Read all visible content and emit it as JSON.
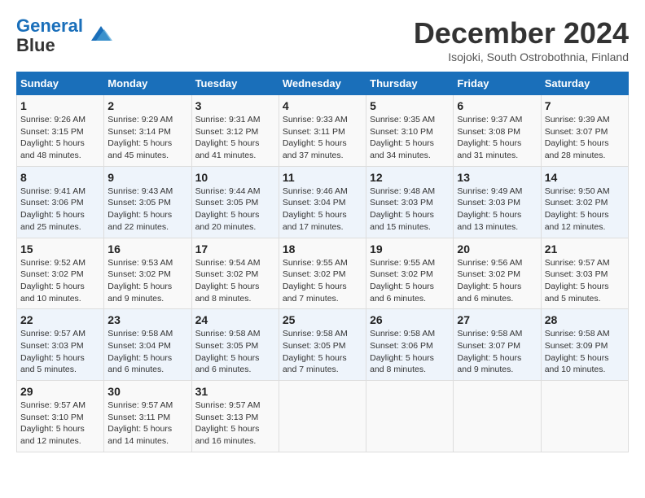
{
  "header": {
    "logo_line1": "General",
    "logo_line2": "Blue",
    "month_title": "December 2024",
    "location": "Isojoki, South Ostrobothnia, Finland"
  },
  "weekdays": [
    "Sunday",
    "Monday",
    "Tuesday",
    "Wednesday",
    "Thursday",
    "Friday",
    "Saturday"
  ],
  "weeks": [
    [
      {
        "day": "1",
        "sunrise": "9:26 AM",
        "sunset": "3:15 PM",
        "daylight": "5 hours and 48 minutes."
      },
      {
        "day": "2",
        "sunrise": "9:29 AM",
        "sunset": "3:14 PM",
        "daylight": "5 hours and 45 minutes."
      },
      {
        "day": "3",
        "sunrise": "9:31 AM",
        "sunset": "3:12 PM",
        "daylight": "5 hours and 41 minutes."
      },
      {
        "day": "4",
        "sunrise": "9:33 AM",
        "sunset": "3:11 PM",
        "daylight": "5 hours and 37 minutes."
      },
      {
        "day": "5",
        "sunrise": "9:35 AM",
        "sunset": "3:10 PM",
        "daylight": "5 hours and 34 minutes."
      },
      {
        "day": "6",
        "sunrise": "9:37 AM",
        "sunset": "3:08 PM",
        "daylight": "5 hours and 31 minutes."
      },
      {
        "day": "7",
        "sunrise": "9:39 AM",
        "sunset": "3:07 PM",
        "daylight": "5 hours and 28 minutes."
      }
    ],
    [
      {
        "day": "8",
        "sunrise": "9:41 AM",
        "sunset": "3:06 PM",
        "daylight": "5 hours and 25 minutes."
      },
      {
        "day": "9",
        "sunrise": "9:43 AM",
        "sunset": "3:05 PM",
        "daylight": "5 hours and 22 minutes."
      },
      {
        "day": "10",
        "sunrise": "9:44 AM",
        "sunset": "3:05 PM",
        "daylight": "5 hours and 20 minutes."
      },
      {
        "day": "11",
        "sunrise": "9:46 AM",
        "sunset": "3:04 PM",
        "daylight": "5 hours and 17 minutes."
      },
      {
        "day": "12",
        "sunrise": "9:48 AM",
        "sunset": "3:03 PM",
        "daylight": "5 hours and 15 minutes."
      },
      {
        "day": "13",
        "sunrise": "9:49 AM",
        "sunset": "3:03 PM",
        "daylight": "5 hours and 13 minutes."
      },
      {
        "day": "14",
        "sunrise": "9:50 AM",
        "sunset": "3:02 PM",
        "daylight": "5 hours and 12 minutes."
      }
    ],
    [
      {
        "day": "15",
        "sunrise": "9:52 AM",
        "sunset": "3:02 PM",
        "daylight": "5 hours and 10 minutes."
      },
      {
        "day": "16",
        "sunrise": "9:53 AM",
        "sunset": "3:02 PM",
        "daylight": "5 hours and 9 minutes."
      },
      {
        "day": "17",
        "sunrise": "9:54 AM",
        "sunset": "3:02 PM",
        "daylight": "5 hours and 8 minutes."
      },
      {
        "day": "18",
        "sunrise": "9:55 AM",
        "sunset": "3:02 PM",
        "daylight": "5 hours and 7 minutes."
      },
      {
        "day": "19",
        "sunrise": "9:55 AM",
        "sunset": "3:02 PM",
        "daylight": "5 hours and 6 minutes."
      },
      {
        "day": "20",
        "sunrise": "9:56 AM",
        "sunset": "3:02 PM",
        "daylight": "5 hours and 6 minutes."
      },
      {
        "day": "21",
        "sunrise": "9:57 AM",
        "sunset": "3:03 PM",
        "daylight": "5 hours and 5 minutes."
      }
    ],
    [
      {
        "day": "22",
        "sunrise": "9:57 AM",
        "sunset": "3:03 PM",
        "daylight": "5 hours and 5 minutes."
      },
      {
        "day": "23",
        "sunrise": "9:58 AM",
        "sunset": "3:04 PM",
        "daylight": "5 hours and 6 minutes."
      },
      {
        "day": "24",
        "sunrise": "9:58 AM",
        "sunset": "3:05 PM",
        "daylight": "5 hours and 6 minutes."
      },
      {
        "day": "25",
        "sunrise": "9:58 AM",
        "sunset": "3:05 PM",
        "daylight": "5 hours and 7 minutes."
      },
      {
        "day": "26",
        "sunrise": "9:58 AM",
        "sunset": "3:06 PM",
        "daylight": "5 hours and 8 minutes."
      },
      {
        "day": "27",
        "sunrise": "9:58 AM",
        "sunset": "3:07 PM",
        "daylight": "5 hours and 9 minutes."
      },
      {
        "day": "28",
        "sunrise": "9:58 AM",
        "sunset": "3:09 PM",
        "daylight": "5 hours and 10 minutes."
      }
    ],
    [
      {
        "day": "29",
        "sunrise": "9:57 AM",
        "sunset": "3:10 PM",
        "daylight": "5 hours and 12 minutes."
      },
      {
        "day": "30",
        "sunrise": "9:57 AM",
        "sunset": "3:11 PM",
        "daylight": "5 hours and 14 minutes."
      },
      {
        "day": "31",
        "sunrise": "9:57 AM",
        "sunset": "3:13 PM",
        "daylight": "5 hours and 16 minutes."
      },
      null,
      null,
      null,
      null
    ]
  ],
  "labels": {
    "sunrise": "Sunrise:",
    "sunset": "Sunset:",
    "daylight": "Daylight:"
  }
}
